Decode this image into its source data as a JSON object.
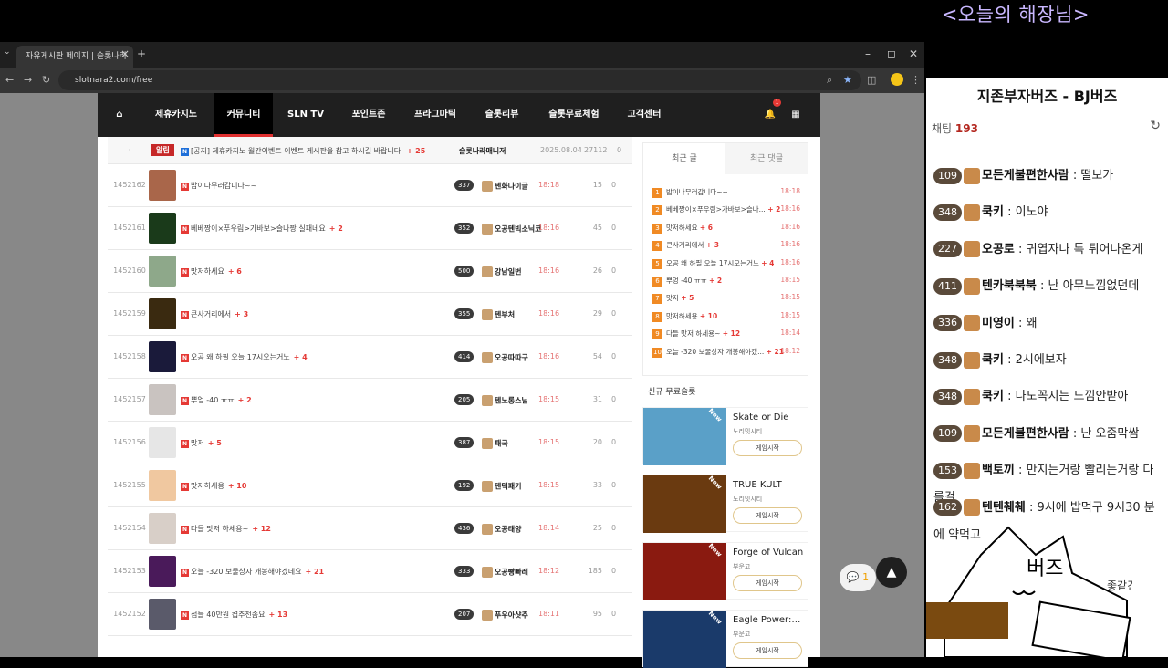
{
  "stream": {
    "title": "<오늘의 해장님>"
  },
  "browser": {
    "tab_title": "자유게시판 페이지 | 슬롯나라",
    "close": "×",
    "newtab": "+",
    "win_min": "–",
    "win_max": "◻",
    "win_close": "✕",
    "url": "slotnara2.com/free",
    "back": "←",
    "forward": "→",
    "reload": "↻"
  },
  "site_nav": {
    "home_icon": "⌂",
    "items": [
      "제휴카지노",
      "커뮤니티",
      "SLN TV",
      "포인트존",
      "프라그마틱",
      "슬롯리뷰",
      "슬롯무료체험",
      "고객센터"
    ],
    "bell": "🔔",
    "grid": "▦",
    "bell_count": "1"
  },
  "notice": {
    "dot": "·",
    "tag": "알림",
    "title": "[공지] 제휴카지노 월간이벤트 이벤트 게시판을 참고 하시길 바랍니다.",
    "comments": "+ 25",
    "author": "슬롯나라매니저",
    "date": "2025.08.04",
    "views": "27112",
    "likes": "0"
  },
  "posts": [
    {
      "num": "1452162",
      "title": "밥이나무러갑니다~~",
      "comments": "",
      "level": "337",
      "author": "텐화나이글",
      "time": "18:18",
      "views": "15",
      "likes": "0",
      "thumb": "#a9664a"
    },
    {
      "num": "1452161",
      "title": "베베짱이×푸우림>가바보>슬나짱 실패네요",
      "comments": "+ 2",
      "level": "352",
      "author": "오공텐빅소닉코",
      "time": "18:16",
      "views": "45",
      "likes": "0",
      "thumb": "#1a3a1a"
    },
    {
      "num": "1452160",
      "title": "맛저하세요",
      "comments": "+ 6",
      "level": "500",
      "author": "강남일번",
      "time": "18:16",
      "views": "26",
      "likes": "0",
      "thumb": "#8ea88a"
    },
    {
      "num": "1452159",
      "title": "큰사거리에서",
      "comments": "+ 3",
      "level": "355",
      "author": "텐부처",
      "time": "18:16",
      "views": "29",
      "likes": "0",
      "thumb": "#3a2a10"
    },
    {
      "num": "1452158",
      "title": "오공 왜 하필 오늘 17시오는거노",
      "comments": "+ 4",
      "level": "414",
      "author": "오공따따구",
      "time": "18:16",
      "views": "54",
      "likes": "0",
      "thumb": "#1a1a3a"
    },
    {
      "num": "1452157",
      "title": "뿌엉 -40 ㅠㅠ",
      "comments": "+ 2",
      "level": "205",
      "author": "텐노롱스님",
      "time": "18:15",
      "views": "31",
      "likes": "0",
      "thumb": "#c9c3c0"
    },
    {
      "num": "1452156",
      "title": "맛저",
      "comments": "+ 5",
      "level": "387",
      "author": "패국",
      "time": "18:15",
      "views": "20",
      "likes": "0",
      "thumb": "#e6e6e6"
    },
    {
      "num": "1452155",
      "title": "맛저하세용",
      "comments": "+ 10",
      "level": "192",
      "author": "텐텍패기",
      "time": "18:15",
      "views": "33",
      "likes": "0",
      "thumb": "#f0c8a0"
    },
    {
      "num": "1452154",
      "title": "다들 맛저 하세용~",
      "comments": "+ 12",
      "level": "436",
      "author": "오공태양",
      "time": "18:14",
      "views": "25",
      "likes": "0",
      "thumb": "#d8cfc8"
    },
    {
      "num": "1452153",
      "title": "오늘 -320 보물상자 개봉해야겠네요",
      "comments": "+ 21",
      "level": "333",
      "author": "오공빵빠레",
      "time": "18:12",
      "views": "185",
      "likes": "0",
      "thumb": "#4a1a5a"
    },
    {
      "num": "1452152",
      "title": "점들 40만원 켭추천좀요",
      "comments": "+ 13",
      "level": "207",
      "author": "푸우아샷추",
      "time": "18:11",
      "views": "95",
      "likes": "0",
      "thumb": "#5a5a6a"
    }
  ],
  "recent": {
    "tab_posts": "최근 글",
    "tab_comments": "최근 댓글",
    "items": [
      {
        "rank": "1",
        "title": "밥이나무러갑니다~~",
        "comments": "",
        "time": "18:18"
      },
      {
        "rank": "2",
        "title": "베베짱이×푸우림>가바보>슬나...",
        "comments": "+ 2",
        "time": "18:16"
      },
      {
        "rank": "3",
        "title": "맛저하세요",
        "comments": "+ 6",
        "time": "18:16"
      },
      {
        "rank": "4",
        "title": "큰사거리에서",
        "comments": "+ 3",
        "time": "18:16"
      },
      {
        "rank": "5",
        "title": "오공 왜 하필 오늘 17시오는거노",
        "comments": "+ 4",
        "time": "18:16"
      },
      {
        "rank": "6",
        "title": "뿌엉 -40 ㅠㅠ",
        "comments": "+ 2",
        "time": "18:15"
      },
      {
        "rank": "7",
        "title": "맛저",
        "comments": "+ 5",
        "time": "18:15"
      },
      {
        "rank": "8",
        "title": "맛저하세용",
        "comments": "+ 10",
        "time": "18:15"
      },
      {
        "rank": "9",
        "title": "다들 맛저 하세용~",
        "comments": "+ 12",
        "time": "18:14"
      },
      {
        "rank": "10",
        "title": "오늘 -320 보물상자 개봉해야겠...",
        "comments": "+ 21",
        "time": "18:12"
      }
    ]
  },
  "new_slots": {
    "label": "신규 무료슬롯",
    "badge": "New",
    "games": [
      {
        "name": "Skate or Die",
        "provider": "노리밋시티",
        "button": "게임시작",
        "color": "#5aa0c8"
      },
      {
        "name": "TRUE KULT",
        "provider": "노리밋시티",
        "button": "게임시작",
        "color": "#6a3a10"
      },
      {
        "name": "Forge of Vulcan",
        "provider": "부운고",
        "button": "게임시작",
        "color": "#8a1a10"
      },
      {
        "name": "Eagle Power:…",
        "provider": "부운고",
        "button": "게임시작",
        "color": "#1a3a6a"
      }
    ]
  },
  "float": {
    "chat_count": "1",
    "chat_icon": "💬",
    "top": "▲"
  },
  "chat": {
    "title": "지존부자버즈 - BJ버즈",
    "viewers_label": "채팅",
    "viewers": "193",
    "refresh": "↻",
    "messages": [
      {
        "level": "109",
        "nick": "모든게불편한사람",
        "text": "떨보가"
      },
      {
        "level": "348",
        "nick": "쿡키",
        "text": "이노야"
      },
      {
        "level": "227",
        "nick": "오공로",
        "text": "귀엽자나 톡 튀어나온게"
      },
      {
        "level": "411",
        "nick": "텐카북북북",
        "text": "난 아무느낌없던데"
      },
      {
        "level": "336",
        "nick": "미영이",
        "text": "왜"
      },
      {
        "level": "348",
        "nick": "쿡키",
        "text": "2시에보자"
      },
      {
        "level": "348",
        "nick": "쿡키",
        "text": "나도꼭지는 느낌안받아"
      },
      {
        "level": "109",
        "nick": "모든게불편한사람",
        "text": "난 오줌막쌈"
      },
      {
        "level": "153",
        "nick": "백토끼",
        "text": "만지는거랑 빨리는거랑 다를걸"
      },
      {
        "level": "162",
        "nick": "텐텐췌췌",
        "text": "9시에 밥먹구 9시30 분에 약먹고"
      }
    ],
    "sep": ":",
    "cat_text": "버즈",
    "trailing": "좋같긴"
  }
}
